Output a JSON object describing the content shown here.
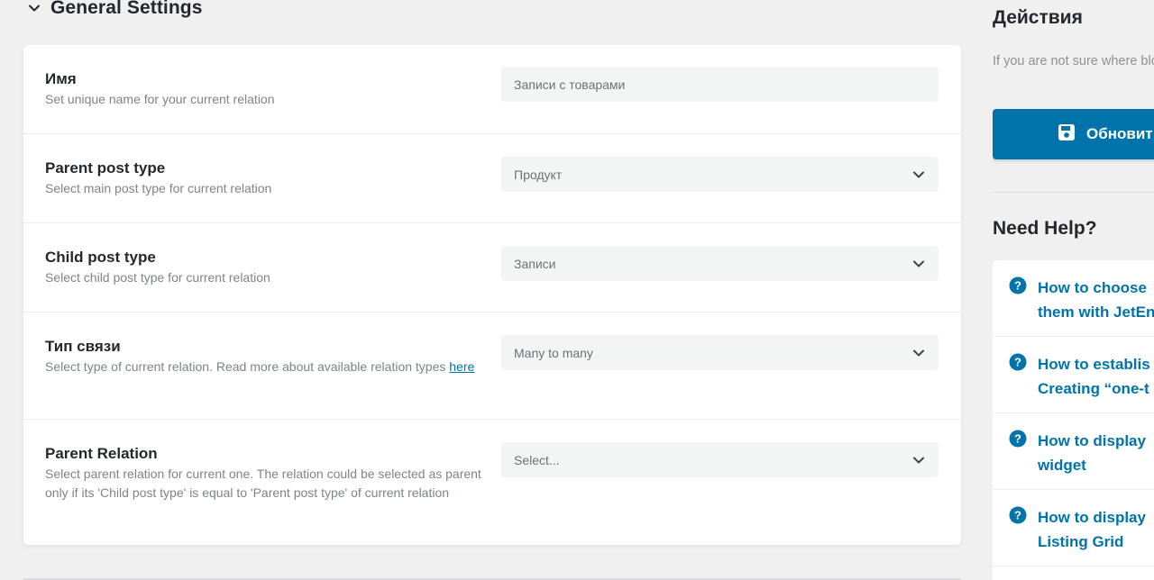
{
  "section": {
    "title": "General Settings",
    "toggle_icon": "chevron-down-icon"
  },
  "fields": [
    {
      "title": "Имя",
      "description": "Set unique name for your current relation",
      "control": "input",
      "value": "Записи с товарами"
    },
    {
      "title": "Parent post type",
      "description": "Select main post type for current relation",
      "control": "select",
      "value": "Продукт"
    },
    {
      "title": "Child post type",
      "description": "Select child post type for current relation",
      "control": "select",
      "value": "Записи"
    },
    {
      "title": "Тип связи",
      "description": "Select type of current relation. Read more about available relation types",
      "link_text": "here",
      "control": "select",
      "value": "Many to many"
    },
    {
      "title": "Parent Relation",
      "description": "Select parent relation for current one. The relation could be selected as parent only if its 'Child post type' is equal to 'Parent post type' of current relation",
      "control": "select",
      "value": "Select..."
    }
  ],
  "sidebar": {
    "actions_title": "Действия",
    "actions_text": "If you are not sure where block",
    "update_label": "Обновит",
    "update_icon": "save-icon",
    "help_title": "Need Help?",
    "help_icon": "question-circle-icon",
    "help_links": [
      {
        "line1": "How to choose",
        "line2": "them with JetEn"
      },
      {
        "line1": "How to establis",
        "line2": "Creating “one-t"
      },
      {
        "line1": "How to display",
        "line2": "widget"
      },
      {
        "line1": "How to display",
        "line2": "Listing Grid"
      }
    ]
  },
  "colors": {
    "accent": "#0073aa",
    "background": "#f0f0f1",
    "card": "#ffffff",
    "field_bg": "#f3f4f4"
  }
}
